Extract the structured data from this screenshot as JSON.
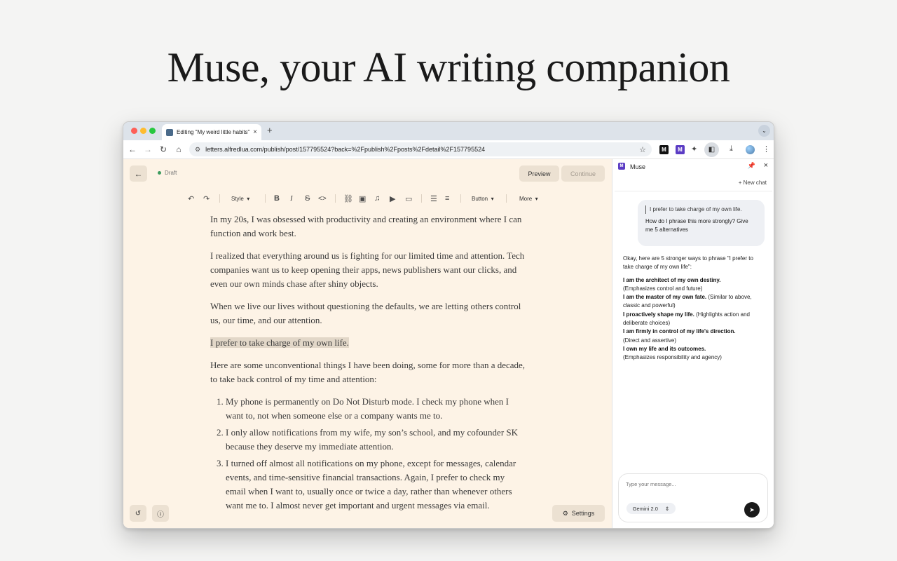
{
  "hero": {
    "title": "Muse, your AI writing companion"
  },
  "browser": {
    "tab_title": "Editing \"My weird little habits\"",
    "tab_close": "×",
    "new_tab": "+",
    "tab_menu": "⌄",
    "url": "letters.alfredlua.com/publish/post/157795524?back=%2Fpublish%2Fposts%2Fdetail%2F157795524",
    "extensions": [
      {
        "label": "M",
        "name": "medium-extension-icon"
      },
      {
        "label": "M",
        "name": "muse-extension-icon"
      }
    ]
  },
  "editor": {
    "status": "Draft",
    "preview_label": "Preview",
    "continue_label": "Continue",
    "style_label": "Style",
    "button_label": "Button",
    "more_label": "More",
    "settings_label": "Settings",
    "paragraphs": [
      "In my 20s, I was obsessed with productivity and creating an environment where I can function and work best.",
      "I realized that everything around us is fighting for our limited time and attention. Tech companies want us to keep opening their apps, news publishers want our clicks, and even our own minds chase after shiny objects.",
      "When we live our lives without questioning the defaults, we are letting others control us, our time, and our attention.",
      "I prefer to take charge of my own life.",
      "Here are some unconventional things I have been doing, some for more than a decade, to take back control of my time and attention:"
    ],
    "list_items": [
      "My phone is permanently on Do Not Disturb mode. I check my phone when I want to, not when someone else or a company wants me to.",
      "I only allow notifications from my wife, my son’s school, and my cofounder SK because they deserve my immediate attention.",
      "I turned off almost all notifications on my phone, except for messages, calendar events, and time-sensitive financial transactions. Again, I prefer to check my email when I want to, usually once or twice a day, rather than whenever others want me to. I almost never get important and urgent messages via email."
    ]
  },
  "panel": {
    "name": "Muse",
    "logo": "M",
    "new_chat": "New chat",
    "user_quote": "I prefer to take charge of my own life.",
    "user_message": "How do I phrase this more strongly? Give me 5 alternatives",
    "reply_intro": "Okay, here are 5 stronger ways to phrase \"I prefer to take charge of my own life\":",
    "alternatives": [
      {
        "bold": "I am the architect of my own destiny.",
        "note": "(Emphasizes control and future)"
      },
      {
        "bold": "I am the master of my own fate.",
        "note": "(Similar to above, classic and powerful)"
      },
      {
        "bold": "I proactively shape my life.",
        "note": "(Highlights action and deliberate choices)"
      },
      {
        "bold": "I am firmly in control of my life's direction.",
        "note": "(Direct and assertive)"
      },
      {
        "bold": "I own my life and its outcomes.",
        "note": "(Emphasizes responsibility and agency)"
      }
    ],
    "input_placeholder": "Type your message...",
    "model": "Gemini 2.0"
  }
}
